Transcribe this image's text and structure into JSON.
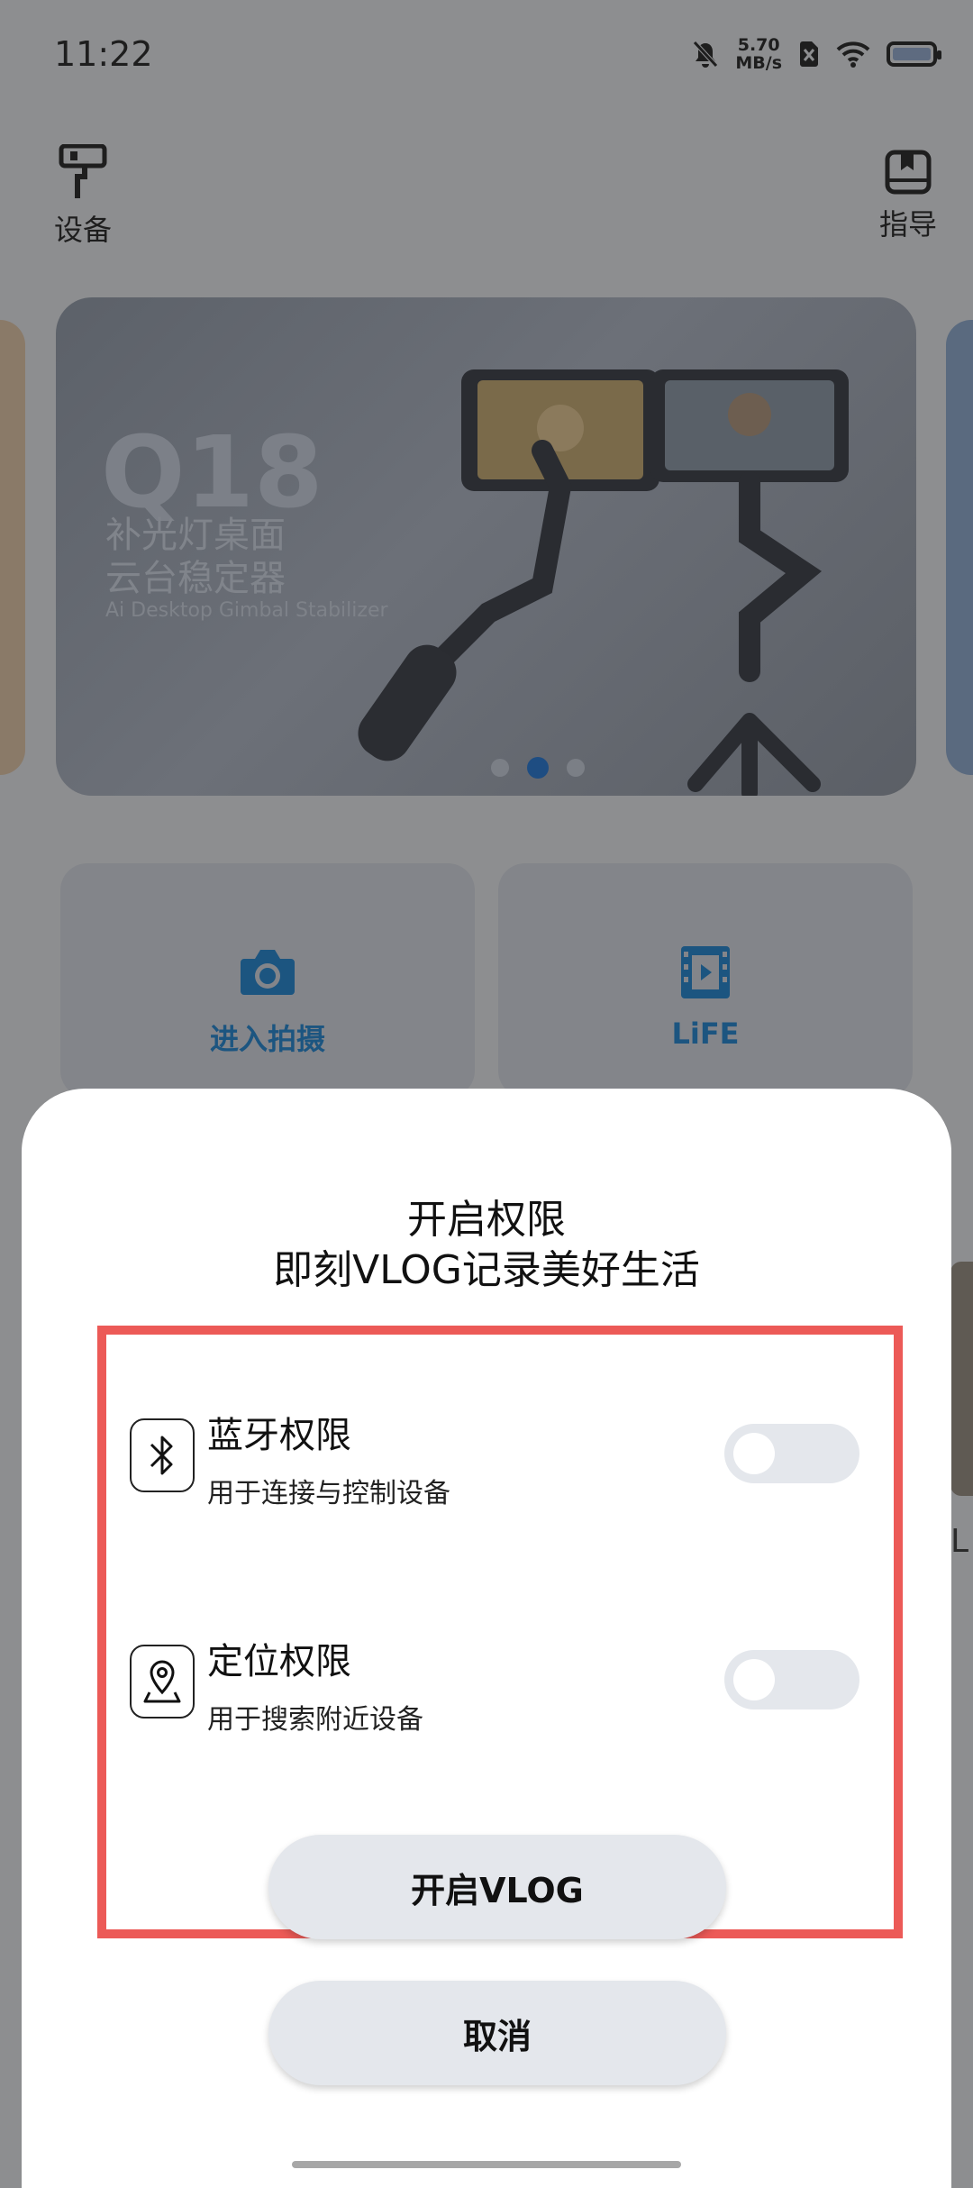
{
  "status_bar": {
    "time": "11:22",
    "net_speed_value": "5.70",
    "net_speed_unit": "MB/s",
    "icons": [
      "mute-icon",
      "sim-off-icon",
      "wifi-icon",
      "battery-icon"
    ]
  },
  "nav": {
    "devices_label": "设备",
    "guide_label": "指导"
  },
  "banner": {
    "model": "Q18",
    "title_line1": "补光灯桌面",
    "title_line2": "云台稳定器",
    "subtitle_en": "Ai Desktop Gimbal Stabilizer",
    "page_count": 3,
    "active_page": 2
  },
  "tiles": {
    "shoot_label": "进入拍摄",
    "life_label": "LiFE"
  },
  "side_peek_text": "L",
  "dialog": {
    "title_line1": "开启权限",
    "title_line2": "即刻VLOG记录美好生活",
    "permissions": [
      {
        "title": "蓝牙权限",
        "desc": "用于连接与控制设备",
        "icon": "bluetooth-icon",
        "enabled": false
      },
      {
        "title": "定位权限",
        "desc": "用于搜索附近设备",
        "icon": "location-icon",
        "enabled": false
      }
    ],
    "confirm_label": "开启VLOG",
    "cancel_label": "取消"
  },
  "colors": {
    "highlight_border": "#ec5a57",
    "accent_blue": "#1c5580",
    "button_bg": "#e4e7ec"
  }
}
